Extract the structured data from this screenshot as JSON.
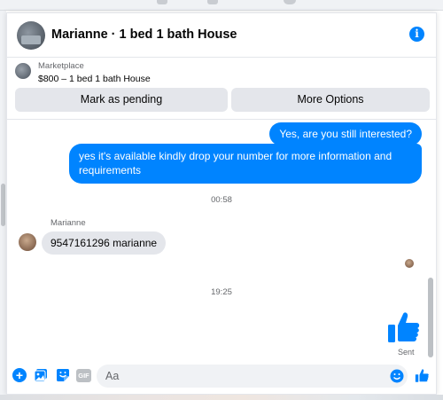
{
  "header": {
    "title": "Marianne · 1 bed 1 bath House"
  },
  "listing": {
    "source_label": "Marketplace",
    "price_title": "$800 – 1 bed 1 bath House",
    "mark_pending_label": "Mark as pending",
    "more_options_label": "More Options"
  },
  "messages": {
    "outgoing_1": "Yes, are you still interested?",
    "outgoing_2": "yes it's available kindly drop your number for more information and requirements",
    "time_1": "00:58",
    "sender_name": "Marianne",
    "incoming_1": "9547161296 marianne",
    "time_2": "19:25",
    "sent_status": "Sent"
  },
  "composer": {
    "placeholder": "Aa",
    "gif_label": "GIF"
  },
  "colors": {
    "accent": "#0084ff",
    "bubble_incoming": "#e4e6eb",
    "secondary_text": "#65676b"
  }
}
